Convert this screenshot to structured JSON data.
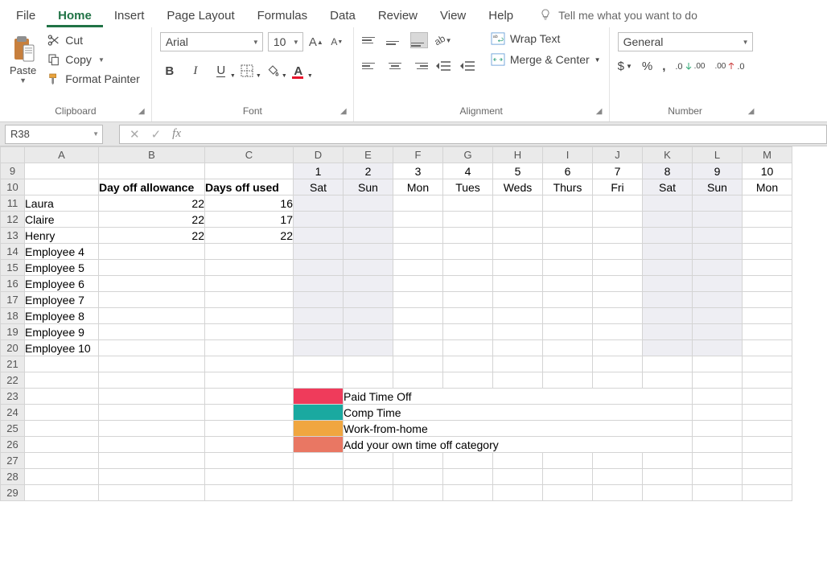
{
  "menu": {
    "items": [
      "File",
      "Home",
      "Insert",
      "Page Layout",
      "Formulas",
      "Data",
      "Review",
      "View",
      "Help"
    ],
    "active_index": 1,
    "tellme": "Tell me what you want to do"
  },
  "ribbon": {
    "clipboard": {
      "label": "Clipboard",
      "paste": "Paste",
      "cut": "Cut",
      "copy": "Copy",
      "format_painter": "Format Painter"
    },
    "font": {
      "label": "Font",
      "font_name": "Arial",
      "font_size": "10"
    },
    "alignment": {
      "label": "Alignment",
      "wrap": "Wrap Text",
      "merge": "Merge & Center"
    },
    "number": {
      "label": "Number",
      "format": "General"
    }
  },
  "namebox": "R38",
  "columns": [
    "A",
    "B",
    "C",
    "D",
    "E",
    "F",
    "G",
    "H",
    "I",
    "J",
    "K",
    "L",
    "M"
  ],
  "selected_col_index": 10,
  "rows_header": [
    9,
    10,
    11,
    12,
    13,
    14,
    15,
    16,
    17,
    18,
    19,
    20,
    21,
    22,
    23,
    24,
    25,
    26,
    27,
    28,
    29
  ],
  "header_row_numbers": [
    "1",
    "2",
    "3",
    "4",
    "5",
    "6",
    "7",
    "8",
    "9",
    "10"
  ],
  "header_row_days": [
    "Sat",
    "Sun",
    "Mon",
    "Tues",
    "Weds",
    "Thurs",
    "Fri",
    "Sat",
    "Sun",
    "Mon"
  ],
  "field_labels": {
    "allowance": "Day off allowance",
    "used": "Days off used"
  },
  "employees": [
    {
      "name": "Laura",
      "allowance": 22,
      "used": 16
    },
    {
      "name": "Claire",
      "allowance": 22,
      "used": 17
    },
    {
      "name": "Henry",
      "allowance": 22,
      "used": 22
    },
    {
      "name": "Employee 4"
    },
    {
      "name": "Employee 5"
    },
    {
      "name": "Employee 6"
    },
    {
      "name": "Employee 7"
    },
    {
      "name": "Employee 8"
    },
    {
      "name": "Employee 9"
    },
    {
      "name": "Employee 10"
    }
  ],
  "legend": [
    {
      "color": "#ef3b5b",
      "label": "Paid Time Off"
    },
    {
      "color": "#1aa9a0",
      "label": "Comp Time"
    },
    {
      "color": "#f0a640",
      "label": "Work-from-home"
    },
    {
      "color": "#e97763",
      "label": "Add your own time off category"
    }
  ]
}
